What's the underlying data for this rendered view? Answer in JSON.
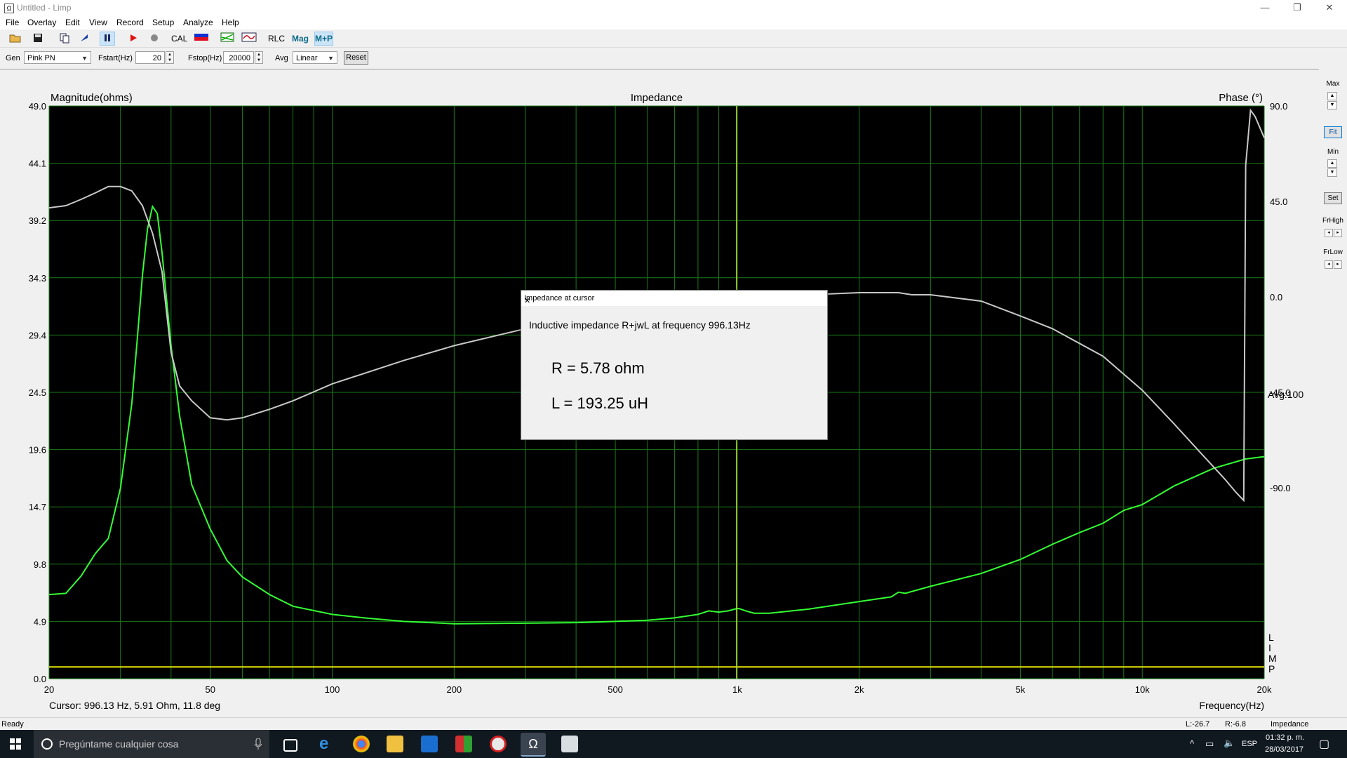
{
  "window": {
    "title": "Untitled - Limp",
    "minimize": "—",
    "restore": "❐",
    "close": "✕"
  },
  "menu": [
    "File",
    "Overlay",
    "Edit",
    "View",
    "Record",
    "Setup",
    "Analyze",
    "Help"
  ],
  "toolbar": {
    "cal": "CAL",
    "rlc": "RLC",
    "mag": "Mag",
    "mp": "M+P"
  },
  "controls": {
    "gen_label": "Gen",
    "gen_value": "Pink PN",
    "fstart_label": "Fstart(Hz)",
    "fstart_value": "20",
    "fstop_label": "Fstop(Hz)",
    "fstop_value": "20000",
    "avg_label": "Avg",
    "avg_value": "Linear",
    "reset": "Reset"
  },
  "chart_data": {
    "type": "line",
    "title": "Impedance",
    "ylabel": "Magnitude(ohms)",
    "y2label": "Phase (°)",
    "xlabel": "Frequency(Hz)",
    "x_scale": "log",
    "xlim": [
      20,
      20000
    ],
    "ylim": [
      0,
      49
    ],
    "y2lim": [
      -180,
      90
    ],
    "grid": true,
    "background": "#000000",
    "yticks": [
      "49.0",
      "44.1",
      "39.2",
      "34.3",
      "29.4",
      "24.5",
      "19.6",
      "14.7",
      "9.8",
      "4.9",
      "0.0"
    ],
    "y2ticks": [
      "90.0",
      "45.0",
      "0.0",
      "-45.0",
      "-90.0"
    ],
    "xticks": [
      {
        "v": 20,
        "l": "20"
      },
      {
        "v": 50,
        "l": "50"
      },
      {
        "v": 100,
        "l": "100"
      },
      {
        "v": 200,
        "l": "200"
      },
      {
        "v": 500,
        "l": "500"
      },
      {
        "v": 1000,
        "l": "1k"
      },
      {
        "v": 2000,
        "l": "2k"
      },
      {
        "v": 5000,
        "l": "5k"
      },
      {
        "v": 10000,
        "l": "10k"
      },
      {
        "v": 20000,
        "l": "20k"
      }
    ],
    "avg_label": "Avg:100",
    "side_letters": [
      "L",
      "I",
      "M",
      "P"
    ],
    "cursor_x": 996.13,
    "cursor_text": "Cursor: 996.13 Hz, 5.91 Ohm, 11.8 deg",
    "series": [
      {
        "color": "#33ff33",
        "axis": "magnitude",
        "x": [
          20,
          22,
          24,
          26,
          28,
          30,
          32,
          33,
          34,
          35,
          36,
          37,
          38,
          40,
          42,
          45,
          50,
          55,
          60,
          70,
          80,
          100,
          120,
          150,
          200,
          300,
          400,
          500,
          600,
          700,
          800,
          850,
          900,
          950,
          996,
          1010,
          1050,
          1100,
          1200,
          1500,
          2000,
          2400,
          2500,
          2600,
          3000,
          4000,
          5000,
          6000,
          7000,
          8000,
          9000,
          10000,
          12000,
          15000,
          18000,
          20000
        ],
        "y": [
          7.2,
          7.3,
          8.8,
          10.7,
          12.0,
          16.3,
          23.5,
          29.0,
          34.5,
          38.5,
          40.4,
          39.8,
          36.5,
          28.5,
          22.5,
          16.6,
          12.8,
          10.1,
          8.7,
          7.2,
          6.2,
          5.5,
          5.2,
          4.9,
          4.7,
          4.75,
          4.8,
          4.9,
          5.0,
          5.2,
          5.5,
          5.8,
          5.7,
          5.8,
          6.0,
          6.0,
          5.8,
          5.6,
          5.6,
          5.95,
          6.6,
          7.0,
          7.4,
          7.3,
          7.9,
          9.0,
          10.2,
          11.5,
          12.5,
          13.3,
          14.4,
          14.9,
          16.5,
          18.0,
          18.8,
          19.0
        ]
      },
      {
        "color": "#c8c8c8",
        "axis": "phase",
        "x": [
          20,
          22,
          24,
          26,
          28,
          30,
          32,
          34,
          36,
          38,
          40,
          42,
          45,
          50,
          55,
          60,
          70,
          80,
          100,
          150,
          200,
          300,
          500,
          700,
          800,
          900,
          950,
          1000,
          1050,
          1100,
          1200,
          1500,
          2000,
          2500,
          2700,
          3000,
          4000,
          5000,
          6000,
          8000,
          10000,
          12000,
          14000,
          16000,
          17000,
          17800,
          18000,
          18500,
          19000,
          20000
        ],
        "y": [
          42,
          43,
          46,
          49,
          52,
          52,
          50,
          43,
          30,
          12,
          -26,
          -42,
          -49,
          -57,
          -58,
          -57,
          -53,
          -49,
          -41,
          -30,
          -23,
          -15,
          -9,
          -5,
          -4,
          -6,
          -3,
          -4,
          -2,
          -3,
          -1,
          1,
          2,
          2,
          1,
          1,
          -2,
          -9,
          -15,
          -28,
          -44,
          -60,
          -74,
          -86,
          -92,
          -96,
          62,
          88,
          85,
          75
        ]
      },
      {
        "color": "#e6e600",
        "axis": "magnitude",
        "x": [
          20,
          100,
          1000,
          10000,
          20000
        ],
        "y": [
          1.0,
          1.0,
          1.0,
          1.0,
          1.0
        ]
      }
    ]
  },
  "dialog": {
    "title": "Impedance at cursor",
    "message": "Inductive impedance R+jwL at frequency 996.13Hz",
    "r_line": "R = 5.78 ohm",
    "l_line": "L = 193.25 uH",
    "close": "✕"
  },
  "right_panel": {
    "max": "Max",
    "fit": "Fit",
    "min": "Min",
    "set": "Set",
    "frhigh": "FrHigh",
    "frlow": "FrLow"
  },
  "status": {
    "left": "Ready",
    "l_value": "L:-26.7",
    "r_value": "R:-6.8",
    "mode": "Impedance Measuremen"
  },
  "taskbar": {
    "search_placeholder": "Pregúntame cualquier cosa",
    "lang": "ESP",
    "time": "01:32 p. m.",
    "date": "28/03/2017"
  }
}
